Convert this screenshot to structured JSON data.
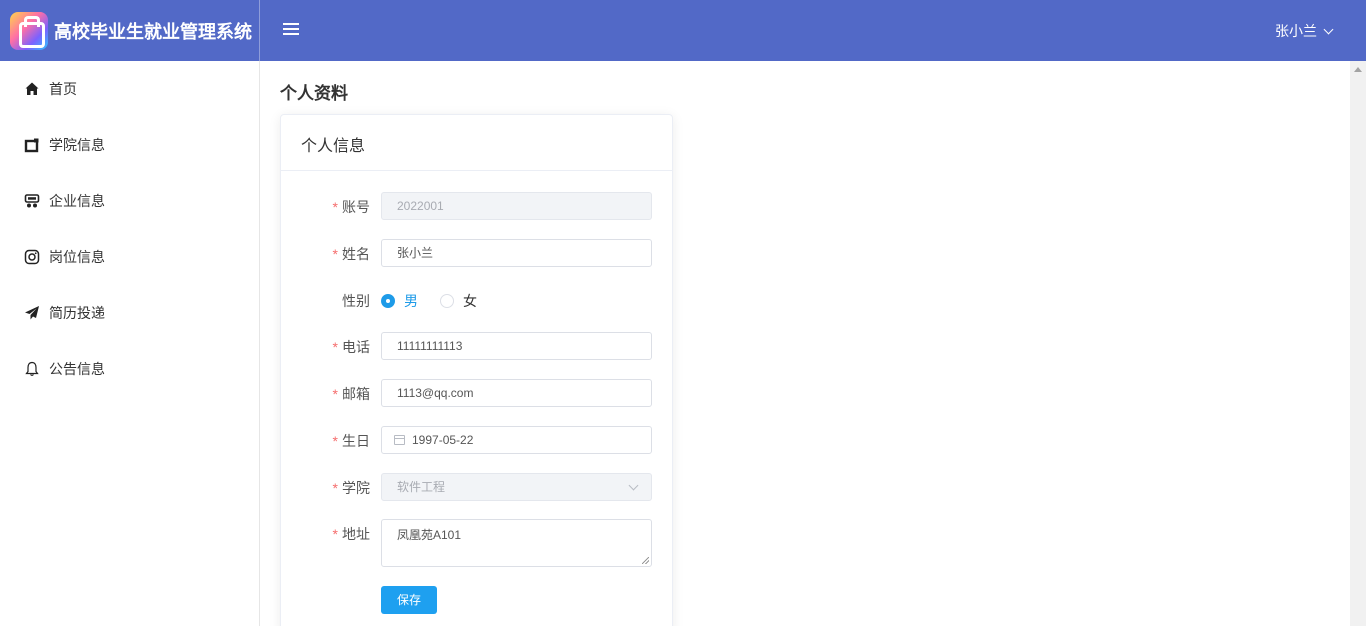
{
  "header": {
    "app_title": "高校毕业生就业管理系统",
    "user_name": "张小兰",
    "brand_color": "#5269c7"
  },
  "sidebar": {
    "items": [
      {
        "label": "首页",
        "icon": "home-icon"
      },
      {
        "label": "学院信息",
        "icon": "college-icon"
      },
      {
        "label": "企业信息",
        "icon": "company-icon"
      },
      {
        "label": "岗位信息",
        "icon": "position-icon"
      },
      {
        "label": "简历投递",
        "icon": "send-icon"
      },
      {
        "label": "公告信息",
        "icon": "bell-icon"
      }
    ]
  },
  "main": {
    "page_title": "个人资料",
    "card_title": "个人信息",
    "form": {
      "account": {
        "label": "账号",
        "value": "2022001",
        "required": true,
        "disabled": true
      },
      "name": {
        "label": "姓名",
        "value": "张小兰",
        "required": true
      },
      "gender": {
        "label": "性别",
        "options": [
          "男",
          "女"
        ],
        "selected": "男"
      },
      "phone": {
        "label": "电话",
        "value": "11111111113",
        "required": true
      },
      "email": {
        "label": "邮箱",
        "value": "1113@qq.com",
        "required": true
      },
      "birthday": {
        "label": "生日",
        "value": "1997-05-22",
        "required": true
      },
      "college": {
        "label": "学院",
        "value": "软件工程",
        "required": true,
        "disabled": true
      },
      "address": {
        "label": "地址",
        "value": "凤凰苑A101",
        "required": true
      }
    },
    "save_label": "保存",
    "required_mark": "*",
    "accent_color": "#1ea0f0"
  }
}
